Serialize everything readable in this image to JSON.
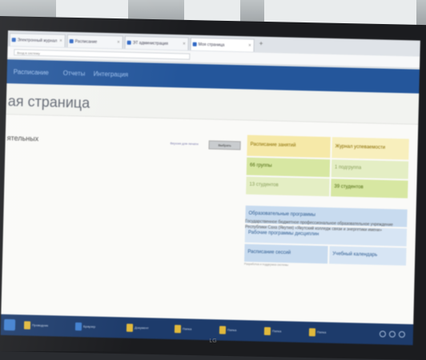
{
  "browser": {
    "tabs": [
      {
        "label": "Электронный журнал"
      },
      {
        "label": "Расписание"
      },
      {
        "label": "ЭТ администрация"
      },
      {
        "label": "Моя страница"
      }
    ],
    "address": "Вход в систему"
  },
  "nav": {
    "items": [
      "Расписание",
      "Отчеты",
      "Интеграция"
    ]
  },
  "page": {
    "title": "ая страница",
    "left_label": "ятельных",
    "print_link": "Версия для печати",
    "print_button": "Выбрать"
  },
  "tiles": {
    "schedule": "Расписание занятий",
    "journal": "Журнал успеваемости",
    "groups": "66 группы",
    "subgroups": "1 подгруппа",
    "students_total": "13 студентов",
    "students_active": "39 студентов",
    "programs": "Образовательные программы",
    "work_programs": "Рабочие программы дисциплин",
    "sessions": "Расписание сессий",
    "curriculum": "Учебный календарь"
  },
  "info": {
    "text": "Государственное бюджетное профессиональное образовательное учреждение Республики Саха (Якутия) «Якутский колледж связи и энергетики имени»",
    "small": "Разработка и поддержка системы"
  },
  "taskbar": {
    "items": [
      "Проводник",
      "Браузер",
      "Документ",
      "Папка",
      "Папка",
      "Папка",
      "Папка"
    ]
  },
  "monitor": {
    "brand": "LG"
  },
  "colors": {
    "nav_bg": "#24569b",
    "yellow_tile": "#f6e9a8",
    "green_tile": "#d7e7a2",
    "blue_tile": "#c8dbef",
    "taskbar_bg": "#1d3b6b"
  }
}
